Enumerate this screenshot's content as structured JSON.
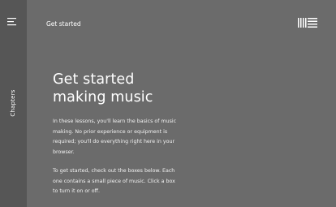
{
  "sidebar": {
    "menu_icon": "menu-icon",
    "chapters_label": "Chapters"
  },
  "header": {
    "title": "Get started",
    "logo_icon": "ableton-logo-icon"
  },
  "hero": {
    "title_line1": "Get started",
    "title_line2": "making music"
  },
  "content": {
    "paragraph1": "In these lessons, you'll learn the basics of music making. No prior experience or equipment is required; you'll do everything right here in your browser.",
    "paragraph2": "To get started, check out the boxes below. Each one contains a small piece of music. Click a box to turn it on or off."
  },
  "colors": {
    "sidebar_bg": "#565656",
    "main_bg": "#6b6b6b",
    "text": "#ffffff"
  }
}
